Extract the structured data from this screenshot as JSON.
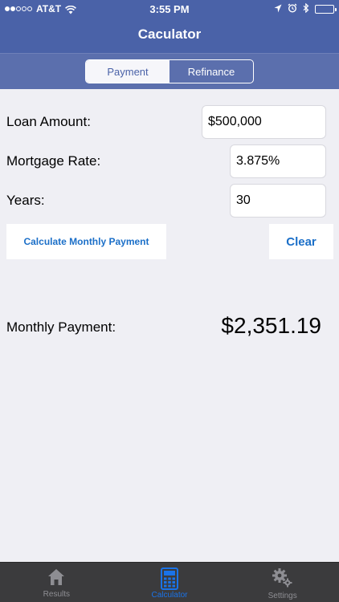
{
  "status_bar": {
    "carrier": "AT&T",
    "time": "3:55 PM"
  },
  "nav": {
    "title": "Caculator"
  },
  "segments": {
    "payment": "Payment",
    "refinance": "Refinance",
    "selected": "payment"
  },
  "form": {
    "loan_amount_label": "Loan Amount:",
    "loan_amount_value": "$500,000",
    "rate_label": "Mortgage Rate:",
    "rate_value": "3.875%",
    "years_label": "Years:",
    "years_value": "30"
  },
  "actions": {
    "calculate_label": "Calculate Monthly Payment",
    "clear_label": "Clear"
  },
  "result": {
    "label": "Monthly Payment:",
    "value": "$2,351.19"
  },
  "tabs": [
    {
      "label": "Results",
      "icon": "home-icon",
      "active": false
    },
    {
      "label": "Calculator",
      "icon": "calculator-icon",
      "active": true
    },
    {
      "label": "Settings",
      "icon": "gears-icon",
      "active": false
    }
  ],
  "colors": {
    "nav_bar": "#4a62a8",
    "toolbar": "#5b6fad",
    "accent": "#1a73e8",
    "tab_bar": "#3b3b3d",
    "background": "#efeff4"
  }
}
